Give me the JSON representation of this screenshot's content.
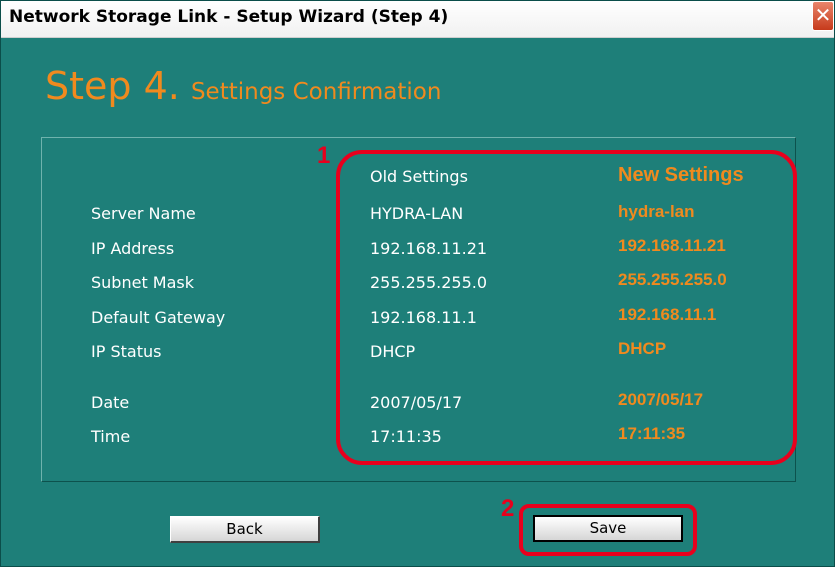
{
  "window": {
    "title": "Network Storage Link - Setup Wizard (Step 4)",
    "close_glyph": "✕"
  },
  "heading": {
    "step": "Step 4.",
    "subtitle": "Settings Confirmation"
  },
  "columns": {
    "old": "Old Settings",
    "new": "New Settings"
  },
  "rows": [
    {
      "label": "Server Name",
      "old": "HYDRA-LAN",
      "new": "hydra-lan"
    },
    {
      "label": "IP Address",
      "old": "192.168.11.21",
      "new": "192.168.11.21"
    },
    {
      "label": "Subnet Mask",
      "old": "255.255.255.0",
      "new": "255.255.255.0"
    },
    {
      "label": "Default Gateway",
      "old": "192.168.11.1",
      "new": "192.168.11.1"
    },
    {
      "label": "IP Status",
      "old": "DHCP",
      "new": "DHCP"
    },
    {
      "label": "Date",
      "old": "2007/05/17",
      "new": "2007/05/17"
    },
    {
      "label": "Time",
      "old": "17:11:35",
      "new": "17:11:35"
    }
  ],
  "annotations": {
    "marker_1": "1",
    "marker_2": "2"
  },
  "buttons": {
    "back": "Back",
    "save": "Save"
  },
  "colors": {
    "window_bg": "#1e7f79",
    "accent_orange": "#f08a1e",
    "annotation_red": "#e8001d"
  }
}
